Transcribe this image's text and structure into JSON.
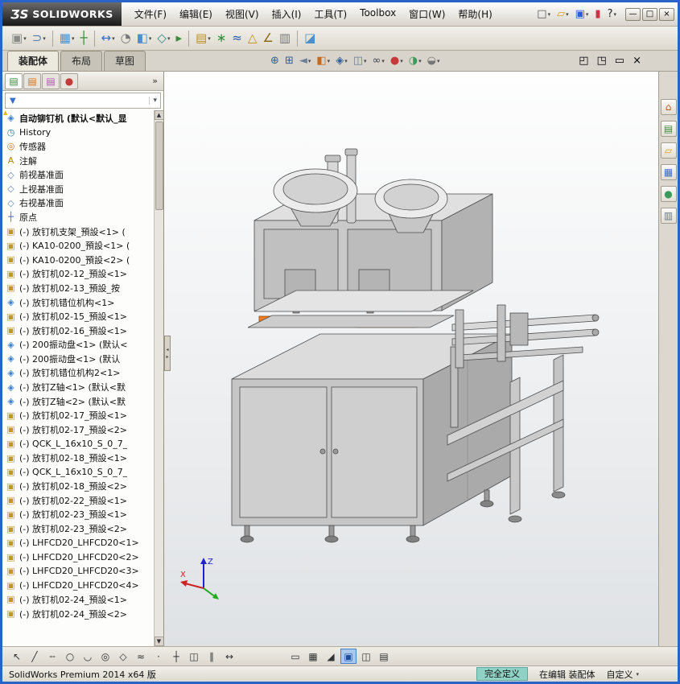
{
  "titlebar": {
    "logo_mark": "ƷS",
    "logo_text": "SOLIDWORKS",
    "menus": [
      "文件(F)",
      "编辑(E)",
      "视图(V)",
      "插入(I)",
      "工具(T)",
      "Toolbox",
      "窗口(W)",
      "帮助(H)"
    ],
    "quick_icons": [
      {
        "name": "new-document",
        "glyph": "□",
        "color": "#555555",
        "caret": true
      },
      {
        "name": "open-document",
        "glyph": "▱",
        "color": "#d8a020",
        "caret": true
      },
      {
        "name": "save-document",
        "glyph": "▣",
        "color": "#2c5fd8",
        "caret": true
      },
      {
        "name": "toolbox-light",
        "glyph": "▮",
        "color": "#cc3344"
      },
      {
        "name": "help",
        "glyph": "?",
        "color": "#222222",
        "caret": true
      }
    ],
    "controls": [
      {
        "name": "minimize-button",
        "glyph": "—"
      },
      {
        "name": "maximize-button",
        "glyph": "□"
      },
      {
        "name": "close-button",
        "glyph": "×"
      }
    ]
  },
  "toolbar": {
    "icons": [
      {
        "name": "insert-components",
        "glyph": "▣",
        "color": "#8a8a8a",
        "caret": true
      },
      {
        "name": "mate",
        "glyph": "⊃",
        "color": "#5577aa",
        "caret": true
      },
      {
        "sep": true
      },
      {
        "name": "linear-component-pattern",
        "glyph": "▦",
        "color": "#4a90d0",
        "caret": true
      },
      {
        "name": "smart-fasteners",
        "glyph": "┼",
        "color": "#3a8a3a"
      },
      {
        "sep": true
      },
      {
        "name": "move-component",
        "glyph": "↔",
        "color": "#3a6fd0",
        "caret": true
      },
      {
        "name": "show-hidden-components",
        "glyph": "◔",
        "color": "#777777"
      },
      {
        "name": "assembly-features",
        "glyph": "◧",
        "color": "#4a90d0",
        "caret": true
      },
      {
        "name": "reference-geometry",
        "glyph": "◇",
        "color": "#2e8b8b",
        "caret": true
      },
      {
        "name": "new-motion-study",
        "glyph": "▸",
        "color": "#3a8a3a"
      },
      {
        "sep": true
      },
      {
        "name": "bill-of-materials",
        "glyph": "▤",
        "color": "#c09020",
        "caret": true
      },
      {
        "name": "exploded-view",
        "glyph": "∗",
        "color": "#3a8a3a"
      },
      {
        "name": "explode-line-sketch",
        "glyph": "≈",
        "color": "#2255aa"
      },
      {
        "name": "interference-detection",
        "glyph": "△",
        "color": "#c09020"
      },
      {
        "name": "measure",
        "glyph": "∠",
        "color": "#8b6914"
      },
      {
        "name": "mass-properties",
        "glyph": "▥",
        "color": "#777777"
      },
      {
        "sep": true
      },
      {
        "name": "section-view-tool",
        "glyph": "◪",
        "color": "#4a90d0"
      }
    ]
  },
  "tabs": [
    {
      "label": "装配体",
      "active": true
    },
    {
      "label": "布局",
      "active": false
    },
    {
      "label": "草图",
      "active": false
    }
  ],
  "headsup": {
    "icons": [
      {
        "name": "zoom-to-fit",
        "glyph": "⊕",
        "color": "#33609c"
      },
      {
        "name": "zoom-to-area",
        "glyph": "⊞",
        "color": "#33609c"
      },
      {
        "name": "previous-view",
        "glyph": "◄",
        "color": "#6d7f96",
        "caret": true
      },
      {
        "name": "section-view",
        "glyph": "◧",
        "color": "#c26a1e",
        "caret": true
      },
      {
        "name": "view-orientation",
        "glyph": "◈",
        "color": "#33609c",
        "caret": true
      },
      {
        "name": "display-style",
        "glyph": "◫",
        "color": "#6d7f96",
        "caret": true
      },
      {
        "name": "hide-show-items",
        "glyph": "∞",
        "color": "#444455",
        "caret": true
      },
      {
        "name": "edit-appearance",
        "glyph": "●",
        "color": "#c23a3a",
        "caret": true
      },
      {
        "name": "apply-scene",
        "glyph": "◑",
        "color": "#3a9a5a",
        "caret": true
      },
      {
        "name": "view-settings",
        "glyph": "◒",
        "color": "#777777",
        "caret": true
      }
    ],
    "window_icons": [
      {
        "name": "pane-left-icon",
        "glyph": "◰"
      },
      {
        "name": "pane-split-icon",
        "glyph": "◳"
      },
      {
        "name": "pane-wide-icon",
        "glyph": "▭"
      },
      {
        "name": "pane-close-icon",
        "glyph": "×"
      }
    ]
  },
  "treepanel": {
    "tabs": [
      {
        "name": "featuremanager-tab",
        "glyph": "▤",
        "color": "#3a8a3a",
        "active": true
      },
      {
        "name": "propertymanager-tab",
        "glyph": "▤",
        "color": "#d07020"
      },
      {
        "name": "configurationmanager-tab",
        "glyph": "▤",
        "color": "#b050b0"
      },
      {
        "name": "displaymanager-tab",
        "glyph": "●",
        "color": "#c23a3a"
      }
    ],
    "chevron": "»",
    "funnel": "▼",
    "filter_caret": "▾",
    "scroll_up": "▲",
    "scroll_down": "▼",
    "splitter_left": "◂",
    "splitter_right": "▸"
  },
  "tree": {
    "root_label": "自动铆钉机 (默认<默认_显",
    "icon_glyphs": {
      "history": {
        "glyph": "◷",
        "color": "#2e7d9e"
      },
      "sensors": {
        "glyph": "◎",
        "color": "#c07820"
      },
      "annotations": {
        "glyph": "A",
        "color": "#b8860b"
      },
      "plane": {
        "glyph": "◇",
        "color": "#6a87b0"
      },
      "origin": {
        "glyph": "┼",
        "color": "#3a6fd0"
      },
      "component": {
        "glyph": "▣",
        "color": "#c09a20"
      },
      "assembly": {
        "glyph": "◈",
        "color": "#3a7fd0"
      }
    },
    "items": [
      {
        "type": "history",
        "label": "History"
      },
      {
        "type": "sensors",
        "label": "传感器"
      },
      {
        "type": "annotations",
        "label": "注解"
      },
      {
        "type": "plane",
        "label": "前视基准面"
      },
      {
        "type": "plane",
        "label": "上视基准面"
      },
      {
        "type": "plane",
        "label": "右视基准面"
      },
      {
        "type": "origin",
        "label": "原点"
      },
      {
        "type": "component",
        "label": "(-) 放钉机支架_預設<1> ("
      },
      {
        "type": "component",
        "label": "(-) KA10-0200_預設<1> ("
      },
      {
        "type": "component",
        "label": "(-) KA10-0200_預設<2> ("
      },
      {
        "type": "component",
        "label": "(-) 放钉机02-12_預設<1>"
      },
      {
        "type": "component",
        "label": "(-) 放钉机02-13_預設_按"
      },
      {
        "type": "assembly",
        "label": "(-) 放钉机错位机构<1>"
      },
      {
        "type": "component",
        "label": "(-) 放钉机02-15_預設<1>"
      },
      {
        "type": "component",
        "label": "(-) 放钉机02-16_預設<1>"
      },
      {
        "type": "assembly",
        "label": "(-) 200振动盘<1> (默认<"
      },
      {
        "type": "assembly",
        "label": "(-) 200振动盘<1> (默认"
      },
      {
        "type": "assembly",
        "label": "(-) 放钉机错位机构2<1>"
      },
      {
        "type": "assembly",
        "label": "(-) 放钉Z轴<1> (默认<默"
      },
      {
        "type": "assembly",
        "label": "(-) 放钉Z轴<2> (默认<默"
      },
      {
        "type": "component",
        "label": "(-) 放钉机02-17_預設<1>"
      },
      {
        "type": "component",
        "label": "(-) 放钉机02-17_預設<2>"
      },
      {
        "type": "component",
        "label": "(-) QCK_L_16x10_S_0_7_"
      },
      {
        "type": "component",
        "label": "(-) 放钉机02-18_預設<1>"
      },
      {
        "type": "component",
        "label": "(-) QCK_L_16x10_S_0_7_"
      },
      {
        "type": "component",
        "label": "(-) 放钉机02-18_預設<2>"
      },
      {
        "type": "component",
        "label": "(-) 放钉机02-22_預設<1>"
      },
      {
        "type": "component",
        "label": "(-) 放钉机02-23_預設<1>"
      },
      {
        "type": "component",
        "label": "(-) 放钉机02-23_預設<2>"
      },
      {
        "type": "component",
        "label": "(-) LHFCD20_LHFCD20<1>"
      },
      {
        "type": "component",
        "label": "(-) LHFCD20_LHFCD20<2>"
      },
      {
        "type": "component",
        "label": "(-) LHFCD20_LHFCD20<3>"
      },
      {
        "type": "component",
        "label": "(-) LHFCD20_LHFCD20<4>"
      },
      {
        "type": "component",
        "label": "(-) 放钉机02-24_預設<1>"
      },
      {
        "type": "component",
        "label": "(-) 放钉机02-24_預設<2>"
      }
    ]
  },
  "viewport": {
    "triad": {
      "x": "X",
      "z": "Z"
    }
  },
  "taskpane": {
    "icons": [
      {
        "name": "resources-home-icon",
        "glyph": "⌂",
        "color": "#c25522"
      },
      {
        "name": "design-library-icon",
        "glyph": "▤",
        "color": "#3a8a3a"
      },
      {
        "name": "file-explorer-icon",
        "glyph": "▱",
        "color": "#d8a020"
      },
      {
        "name": "view-palette-icon",
        "glyph": "▦",
        "color": "#3a6fd0"
      },
      {
        "name": "appearances-icon",
        "glyph": "●",
        "color": "#3a9a5a"
      },
      {
        "name": "custom-properties-icon",
        "glyph": "▥",
        "color": "#667788"
      }
    ]
  },
  "sketchbar": {
    "left_icons": [
      {
        "name": "select-tool",
        "glyph": "↖"
      },
      {
        "name": "line-tool",
        "glyph": "╱"
      },
      {
        "name": "centerline-tool",
        "glyph": "╌"
      },
      {
        "name": "circle-tool",
        "glyph": "○"
      },
      {
        "name": "arc-tool",
        "glyph": "◡"
      },
      {
        "name": "ellipse-tool",
        "glyph": "◎"
      },
      {
        "name": "polygon-tool",
        "glyph": "◇"
      },
      {
        "name": "spline-tool",
        "glyph": "≈"
      },
      {
        "name": "point-tool",
        "glyph": "·"
      },
      {
        "name": "trim-tool",
        "glyph": "┼"
      },
      {
        "name": "mirror-tool",
        "glyph": "◫"
      },
      {
        "name": "offset-tool",
        "glyph": "∥"
      },
      {
        "name": "smart-dimension-tool",
        "glyph": "↔"
      }
    ],
    "right_icons": [
      {
        "name": "grid-icon",
        "glyph": "▭"
      },
      {
        "name": "snap-grid-icon",
        "glyph": "▦"
      },
      {
        "name": "corner-snap-icon",
        "glyph": "◢"
      },
      {
        "name": "shaded-sketch-icon",
        "glyph": "▣",
        "active": true,
        "color": "#1d4e9e"
      },
      {
        "name": "split-pane-icon",
        "glyph": "◫"
      },
      {
        "name": "single-pane-icon",
        "glyph": "▤"
      }
    ]
  },
  "statusbar": {
    "left": "SolidWorks Premium 2014 x64 版",
    "defined": "完全定义",
    "editing": "在编辑 装配体",
    "custom": "自定义",
    "caret": "▾"
  }
}
